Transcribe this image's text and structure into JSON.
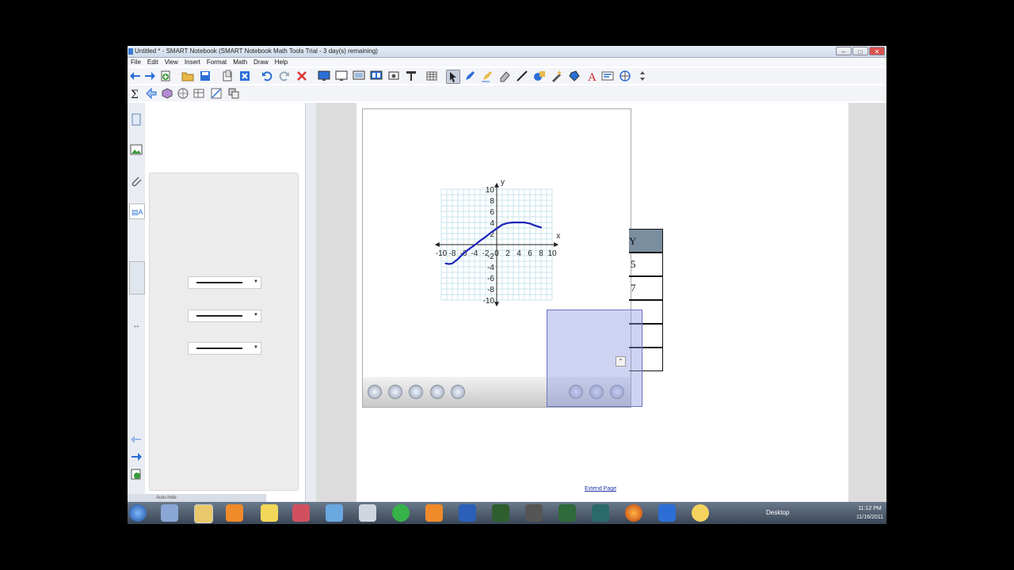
{
  "window": {
    "title": "Untitled * - SMART Notebook (SMART Notebook Math Tools Trial - 3 day(s) remaining)",
    "controls": {
      "minimize": "–",
      "maximize": "□",
      "close": "✕"
    }
  },
  "menu": [
    "File",
    "Edit",
    "View",
    "Insert",
    "Format",
    "Math",
    "Draw",
    "Help"
  ],
  "graph": {
    "x_axis_label": "x",
    "y_axis_label": "y",
    "x_ticks": [
      "-10",
      "-8",
      "-6",
      "-4",
      "-2",
      "0",
      "2",
      "4",
      "6",
      "8",
      "10"
    ],
    "y_ticks": [
      "10",
      "8",
      "6",
      "4",
      "2",
      "-2",
      "-4",
      "-6",
      "-8",
      "-10"
    ],
    "curve_points": [
      [
        -9.2,
        -3.4
      ],
      [
        -8.6,
        -3.5
      ],
      [
        -8,
        -3.4
      ],
      [
        -7,
        -2.6
      ],
      [
        -6,
        -1.6
      ],
      [
        -5,
        -0.8
      ],
      [
        -4,
        -0.1
      ],
      [
        -3,
        0.7
      ],
      [
        -2,
        1.4
      ],
      [
        -1,
        2.2
      ],
      [
        0,
        2.9
      ],
      [
        1,
        3.6
      ],
      [
        2,
        3.9
      ],
      [
        3,
        4.0
      ],
      [
        4,
        4.0
      ],
      [
        5,
        4.0
      ],
      [
        6,
        3.8
      ],
      [
        7,
        3.4
      ],
      [
        8,
        3.1
      ]
    ],
    "curve_color": "#1a22b8",
    "grid_color": "#b8dce8"
  },
  "table": {
    "header": "Y",
    "rows": [
      "5",
      "7",
      "",
      "",
      "",
      ""
    ]
  },
  "extend_page": "Extend Page",
  "autohide": "Auto-hide",
  "taskbar": {
    "desktop_label": "Desktop",
    "time": "11:12 PM",
    "date": "11/16/2011"
  },
  "colors": {
    "accent": "#3a7bd5",
    "overlay": "#8c96e1",
    "table_header": "#7b8ea0"
  }
}
